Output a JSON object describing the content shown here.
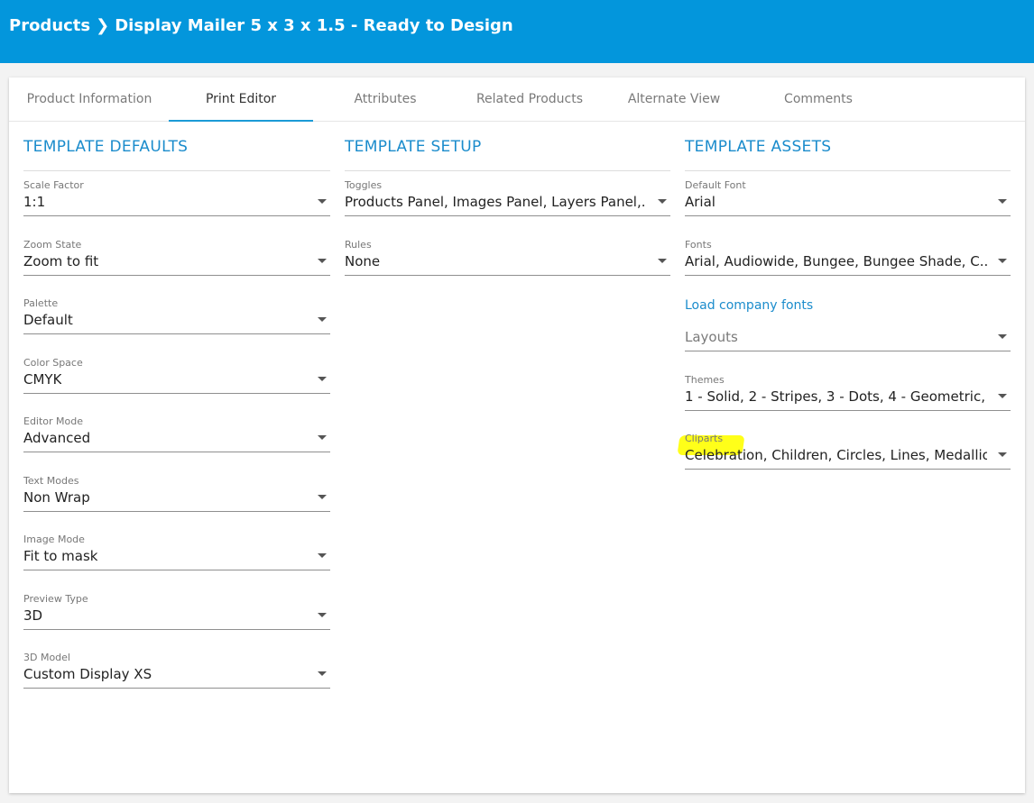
{
  "header": {
    "crumb_root": "Products",
    "separator": "❯",
    "crumb_current": "Display Mailer 5 x 3 x 1.5 - Ready to Design",
    "bg_color": "#0396dc"
  },
  "tabs": [
    {
      "label": "Product Information",
      "active": false
    },
    {
      "label": "Print Editor",
      "active": true
    },
    {
      "label": "Attributes",
      "active": false
    },
    {
      "label": "Related Products",
      "active": false
    },
    {
      "label": "Alternate View",
      "active": false
    },
    {
      "label": "Comments",
      "active": false
    }
  ],
  "sections": {
    "defaults": {
      "title": "TEMPLATE DEFAULTS",
      "fields": [
        {
          "label": "Scale Factor",
          "value": "1:1"
        },
        {
          "label": "Zoom State",
          "value": "Zoom to fit"
        },
        {
          "label": "Palette",
          "value": "Default"
        },
        {
          "label": "Color Space",
          "value": "CMYK"
        },
        {
          "label": "Editor Mode",
          "value": "Advanced"
        },
        {
          "label": "Text Modes",
          "value": "Non Wrap"
        },
        {
          "label": "Image Mode",
          "value": "Fit to mask"
        },
        {
          "label": "Preview Type",
          "value": "3D"
        },
        {
          "label": "3D Model",
          "value": "Custom Display XS"
        }
      ]
    },
    "setup": {
      "title": "TEMPLATE SETUP",
      "fields": [
        {
          "label": "Toggles",
          "value": "Products Panel, Images Panel, Layers Panel,..."
        },
        {
          "label": "Rules",
          "value": "None"
        }
      ]
    },
    "assets": {
      "title": "TEMPLATE ASSETS",
      "fields": [
        {
          "label": "Default Font",
          "value": "Arial"
        },
        {
          "label": "Fonts",
          "value": "Arial, Audiowide, Bungee, Bungee Shade, C..."
        },
        {
          "label": "",
          "value": "Layouts",
          "placeholder": true
        },
        {
          "label": "Themes",
          "value": "1 - Solid, 2 - Stripes, 3 - Dots, 4 - Geometric, ..."
        },
        {
          "label": "Cliparts",
          "value": "Celebration, Children, Circles, Lines, Medallio..."
        }
      ],
      "load_fonts_link": "Load company fonts"
    }
  },
  "colors": {
    "accent": "#1b8ccc",
    "highlight": "#ffff00"
  }
}
